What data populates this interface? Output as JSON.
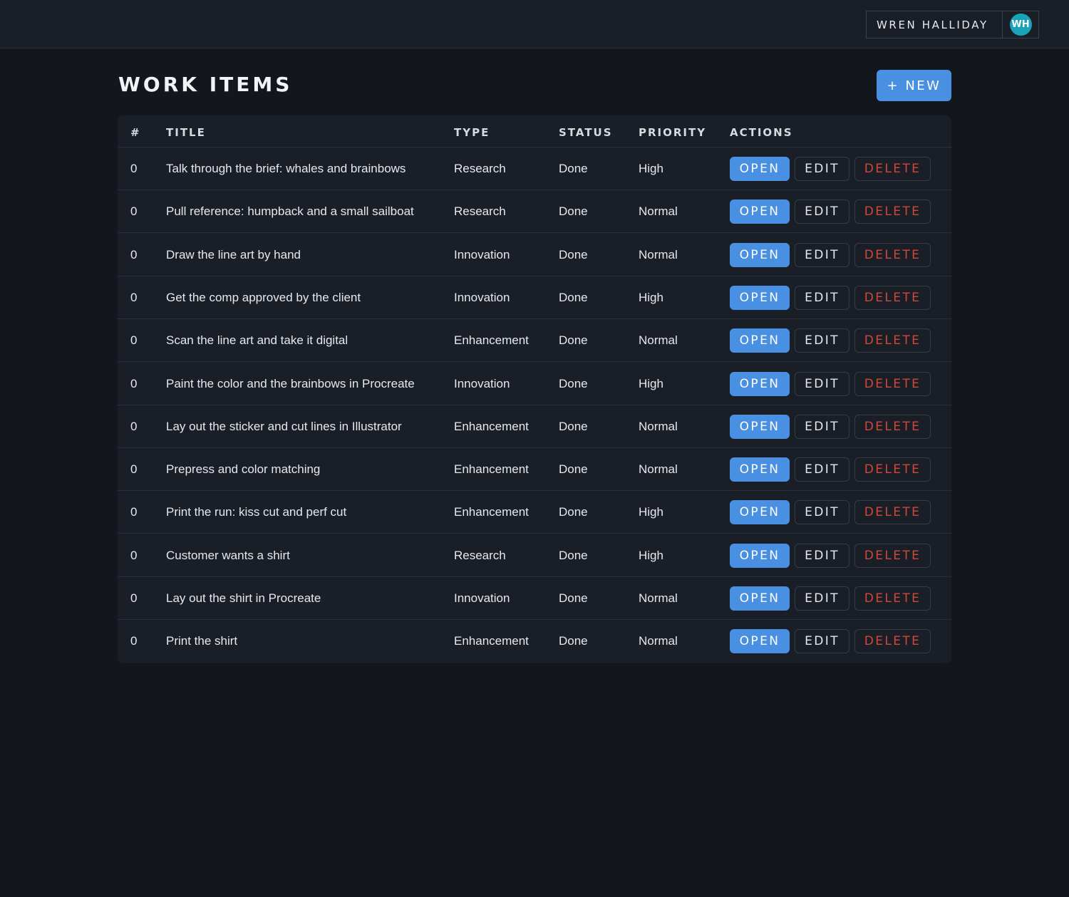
{
  "topbar": {
    "user_name": "WREN HALLIDAY",
    "avatar_initials": "WH",
    "avatar_color": "#18a3b8"
  },
  "page": {
    "title": "WORK ITEMS",
    "new_button_label": "+ NEW"
  },
  "colors": {
    "accent": "#4a90e2",
    "danger": "#d0473b",
    "background": "#13161c",
    "surface": "#1a1e26"
  },
  "table": {
    "columns": [
      "#",
      "TITLE",
      "TYPE",
      "STATUS",
      "PRIORITY",
      "ACTIONS"
    ],
    "action_labels": {
      "open": "OPEN",
      "edit": "EDIT",
      "delete": "DELETE"
    },
    "rows": [
      {
        "num": "0",
        "title": "Talk through the brief: whales and brainbows",
        "type": "Research",
        "status": "Done",
        "priority": "High"
      },
      {
        "num": "0",
        "title": "Pull reference: humpback and a small sailboat",
        "type": "Research",
        "status": "Done",
        "priority": "Normal"
      },
      {
        "num": "0",
        "title": "Draw the line art by hand",
        "type": "Innovation",
        "status": "Done",
        "priority": "Normal"
      },
      {
        "num": "0",
        "title": "Get the comp approved by the client",
        "type": "Innovation",
        "status": "Done",
        "priority": "High"
      },
      {
        "num": "0",
        "title": "Scan the line art and take it digital",
        "type": "Enhancement",
        "status": "Done",
        "priority": "Normal"
      },
      {
        "num": "0",
        "title": "Paint the color and the brainbows in Procreate",
        "type": "Innovation",
        "status": "Done",
        "priority": "High"
      },
      {
        "num": "0",
        "title": "Lay out the sticker and cut lines in Illustrator",
        "type": "Enhancement",
        "status": "Done",
        "priority": "Normal"
      },
      {
        "num": "0",
        "title": "Prepress and color matching",
        "type": "Enhancement",
        "status": "Done",
        "priority": "Normal"
      },
      {
        "num": "0",
        "title": "Print the run: kiss cut and perf cut",
        "type": "Enhancement",
        "status": "Done",
        "priority": "High"
      },
      {
        "num": "0",
        "title": "Customer wants a shirt",
        "type": "Research",
        "status": "Done",
        "priority": "High"
      },
      {
        "num": "0",
        "title": "Lay out the shirt in Procreate",
        "type": "Innovation",
        "status": "Done",
        "priority": "Normal"
      },
      {
        "num": "0",
        "title": "Print the shirt",
        "type": "Enhancement",
        "status": "Done",
        "priority": "Normal"
      }
    ]
  }
}
